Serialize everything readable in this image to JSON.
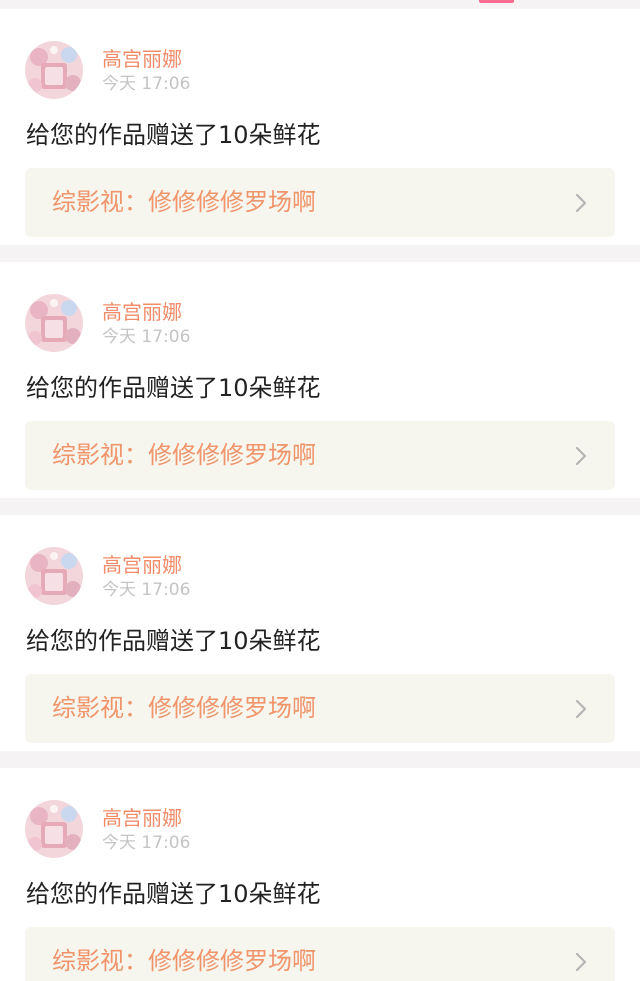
{
  "notifications": [
    {
      "user": {
        "name": "高宫丽娜",
        "avatar_icon": "avatar-image"
      },
      "time": "今天 17:06",
      "message": "给您的作品赠送了10朵鲜花",
      "work": {
        "title": "综影视：修修修修罗场啊",
        "icon": "chevron-right-icon"
      }
    },
    {
      "user": {
        "name": "高宫丽娜",
        "avatar_icon": "avatar-image"
      },
      "time": "今天 17:06",
      "message": "给您的作品赠送了10朵鲜花",
      "work": {
        "title": "综影视：修修修修罗场啊",
        "icon": "chevron-right-icon"
      }
    },
    {
      "user": {
        "name": "高宫丽娜",
        "avatar_icon": "avatar-image"
      },
      "time": "今天 17:06",
      "message": "给您的作品赠送了10朵鲜花",
      "work": {
        "title": "综影视：修修修修罗场啊",
        "icon": "chevron-right-icon"
      }
    },
    {
      "user": {
        "name": "高宫丽娜",
        "avatar_icon": "avatar-image"
      },
      "time": "今天 17:06",
      "message": "给您的作品赠送了10朵鲜花",
      "work": {
        "title": "综影视：修修修修罗场啊",
        "icon": "chevron-right-icon"
      }
    }
  ],
  "colors": {
    "username": "#f28c68",
    "work_title": "#f0946a",
    "timestamp": "#c4c4c4",
    "card_link_bg": "#f6f6ef",
    "divider_bg": "#f5f3f3",
    "accent": "#ff6b8f"
  }
}
